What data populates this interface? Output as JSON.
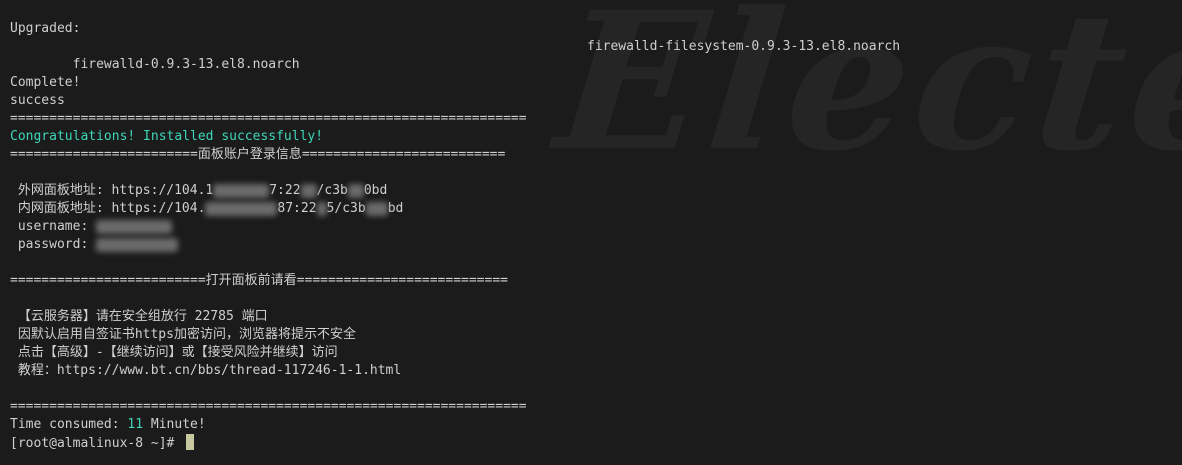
{
  "watermark": "Electer",
  "lines": {
    "l0": "Upgraded:",
    "l1a": "  firewalld-0.9.3-13.el8.noarch",
    "l1b": "firewalld-filesystem-0.9.3-13.el8.noarch",
    "l3": "Complete!",
    "l4": "success",
    "l5": "==================================================================",
    "l6": "Congratulations! Installed successfully!",
    "l7": "========================面板账户登录信息==========================",
    "l9a": " 外网面板地址: https://104.1",
    "l9b": "7:22",
    "l9c": "/c3b",
    "l9d": "0bd",
    "l10a": " 内网面板地址: https://104.",
    "l10b": "87:22",
    "l10c": "5/c3b",
    "l10d": "bd",
    "l11": " username: ",
    "l12": " password: ",
    "l14": "=========================打开面板前请看===========================",
    "l16": " 【云服务器】请在安全组放行 22785 端口",
    "l17": " 因默认启用自签证书https加密访问，浏览器将提示不安全",
    "l18": " 点击【高级】-【继续访问】或【接受风险并继续】访问",
    "l19": " 教程：https://www.bt.cn/bbs/thread-117246-1-1.html",
    "l21": "==================================================================",
    "l22a": "Time consumed: ",
    "l22b": "11",
    "l22c": " Minute!",
    "l23": "[root@almalinux-8 ~]# "
  },
  "colors": {
    "background": "#1b1b1b",
    "text": "#cfcfcf",
    "highlight": "#3dd6b8",
    "cursor": "#c8c8a0"
  }
}
